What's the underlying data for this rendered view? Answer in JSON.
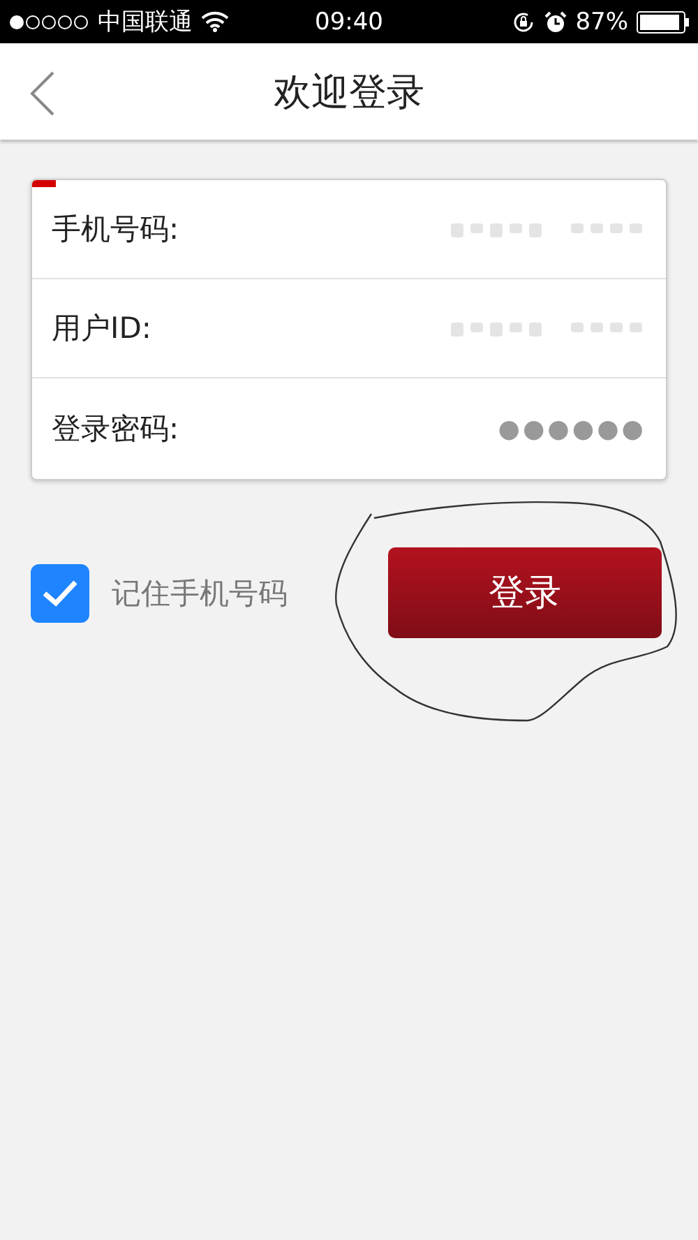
{
  "status_bar": {
    "carrier": "中国联通",
    "time": "09:40",
    "battery": "87%"
  },
  "nav_bar": {
    "title": "欢迎登录"
  },
  "form": {
    "fields": [
      {
        "label": "手机号码:",
        "kind": "blurred"
      },
      {
        "label": "用户ID:",
        "kind": "blurred"
      },
      {
        "label": "登录密码:",
        "kind": "password",
        "value": "●●●●●●"
      }
    ]
  },
  "remember": {
    "label": "记住手机号码",
    "checked": true
  },
  "login_button": {
    "label": "登录"
  }
}
